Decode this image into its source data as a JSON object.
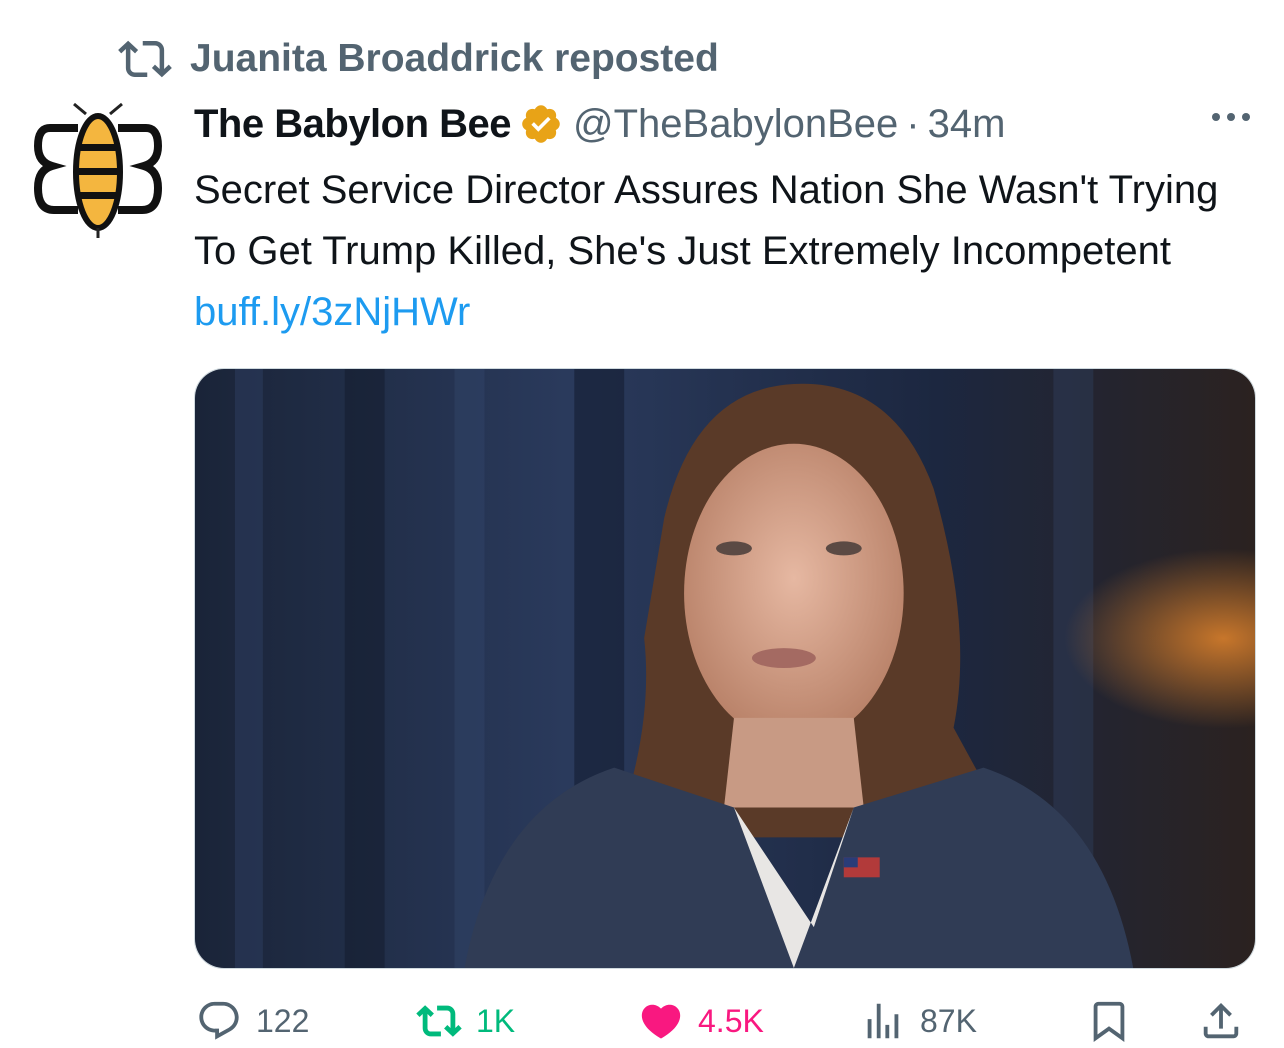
{
  "repost": {
    "label": "Juanita Broaddrick reposted",
    "icon": "retweet-icon"
  },
  "author": {
    "display_name": "The Babylon Bee",
    "handle": "@TheBabylonBee",
    "separator": "·",
    "time": "34m",
    "verified": true,
    "verified_color": "#e8a317",
    "avatar": "babylon-bee-logo"
  },
  "tweet": {
    "text": "Secret Service Director Assures Nation She Wasn't Trying To Get Trump Killed, She's Just Extremely Incompetent",
    "link": "buff.ly/3zNjHWr",
    "media_description_icon": "photo"
  },
  "actions": {
    "replies": "122",
    "retweets": "1K",
    "likes": "4.5K",
    "views": "87K"
  },
  "colors": {
    "text_primary": "#0f1419",
    "text_secondary": "#536471",
    "link": "#1d9bf0",
    "retweet_active": "#00ba7c",
    "like_active": "#f91880"
  }
}
